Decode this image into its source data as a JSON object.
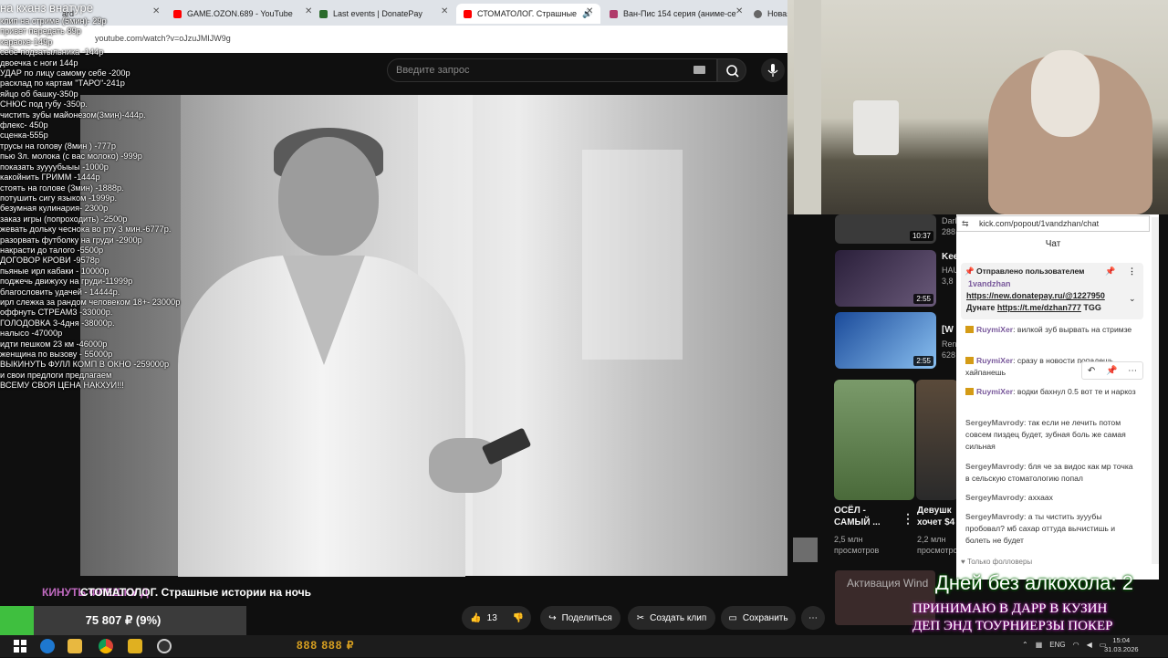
{
  "overlay_title": "на кханз внатуре",
  "price_list": [
    "клип на стриме (5мин)- 29р",
    "привет передать 89р",
    "караоке-149р",
    "себе подзатыльника -144р",
    "двоечка с ноги 144р",
    "УДАР по лицу самому себе -200р",
    "расклад по картам \"ТАРО\"-241р",
    "яйцо об башку-350р",
    "СНЮС под губу -350р.",
    "чистить зубы майонезом(3мин)-444р.",
    "флекс- 450р",
    "сценка-555р",
    "трусы на голову (8мин ) -777р",
    "пью 3л. молока (с вас молоко) -999р",
    "показать зуууубыыы -1000р",
    "какойнить ГРИММ -1444р",
    "стоять на голове (3мин) -1888р.",
    "потушить сигу языком -1999р.",
    "безумная кулинария- 2300р",
    "заказ игры (попроходить) -2500р",
    "жевать дольку чеснока во рту 3 мин.-6777р.",
    "разорвать футболку на груди -2900р",
    "накрасти до талого -5500р",
    "ДОГОВОР КРОВИ -9578р",
    "пьяные ирл кабаки - 10000р",
    "поджечь движуху на груди-11999р",
    "благословить удачей - 14444р.",
    "ирл слежка за рандом человеком 18+- 23000р",
    "оффнуть СТРЕАМ3 -33000р.",
    "ГОЛОДОВКА 3-4дня -38000р.",
    "налысо -47000р",
    "идти пешком 23 км -46000р",
    "женщина по вызову - 55000р",
    "ВЫКИНУТЬ ФУЛЛ КОМП В ОКНО -259000р",
    "и свои предлоги предлагаем",
    "ВСЕМУ СВОЯ ЦЕНА НАКХУИ!!!"
  ],
  "tabs": [
    {
      "label": "ard"
    },
    {
      "label": "GAME.OZON.689 - YouTube"
    },
    {
      "label": "Last events | DonatePay"
    },
    {
      "label": "СТОМАТОЛОГ. Страшные"
    },
    {
      "label": "Ван-Пис 154 серия (аниме-се"
    },
    {
      "label": "Новая"
    }
  ],
  "address": "youtube.com/watch?v=oJzuJMIJW9g",
  "search_placeholder": "Введите запрос",
  "video_title": "СТОМАТОЛОГ. Страшные истории на ночь",
  "overlay_kinut": "КИНУТЬ ФЛЕШКУ Д",
  "donation": {
    "text": "75 807 ₽ (9%)",
    "percent": 9
  },
  "actions": {
    "likes": "13",
    "share": "Поделиться",
    "clip": "Создать клип",
    "save": "Сохранить",
    "more": "⋯"
  },
  "sidebar": [
    {
      "title": "",
      "channel": "Dark",
      "views": "288",
      "duration": "10:37"
    },
    {
      "title": "Kee",
      "channel": "HAU",
      "views": "3,8",
      "duration": "2:55"
    },
    {
      "title": "[W",
      "channel": "Ren",
      "views": "628",
      "duration": "2:55"
    },
    {
      "title": "ОСЁЛ - САМЫЙ ...",
      "views": "2,5 млн",
      "views_label": "просмотров"
    },
    {
      "title": "Девушк хочет $4",
      "views": "2,2 млн",
      "views_label": "просмотров"
    }
  ],
  "chat": {
    "url": "kick.com/popout/1vandzhan/chat",
    "header": "Чат",
    "pinned_label": "Отправлено пользователем",
    "pinned_user": "1vandzhan",
    "pinned_line1": "https://new.donatepay.ru/@1227950",
    "pinned_line2_prefix": "Дунате ",
    "pinned_line2_link": "https://t.me/dzhan777",
    "pinned_line2_suffix": " TGG",
    "messages": [
      {
        "user": "RuymiXer",
        "text": ": вилкой зуб вырвать на стримзе"
      },
      {
        "user": "RuymiXer",
        "text": ": сразу в новости попадешь хайпанешь"
      },
      {
        "user": "RuymiXer",
        "text": ": водки бахнул 0.5 вот те и наркоз"
      },
      {
        "user": "SergeyMavrody",
        "text": ": так если не лечить потом совсем пиздец будет, зубная боль же самая сильная"
      },
      {
        "user": "SergeyMavrody",
        "text": ": бля че за видос как мр точка в сельскую стоматологию попал"
      },
      {
        "user": "SergeyMavrody",
        "text": ": аххаах"
      },
      {
        "user": "SergeyMavrody",
        "text": ": а ты чистить зууубы пробовал? мб сахар оттуда вычистишь и болеть не будет"
      }
    ],
    "followers_only": "Только фолловеры"
  },
  "overlay_bottom": {
    "days": "Дней без алкохола: 2",
    "activation": "Активация Wind",
    "line1": "ПРИНИМАЮ В ДАРР В КУЗИН",
    "line2": "ДЕП ЭНД ТОУРНИЕРЗЫ ПОКЕР"
  },
  "taskbar": {
    "money": "888 888 ₽",
    "lang": "ENG",
    "time": "15:04",
    "date": "31.03.2026"
  },
  "colors": {
    "accent_youtube": "#ff0000",
    "kick_green": "#53fc18",
    "donation_green": "#3fbf3f"
  }
}
